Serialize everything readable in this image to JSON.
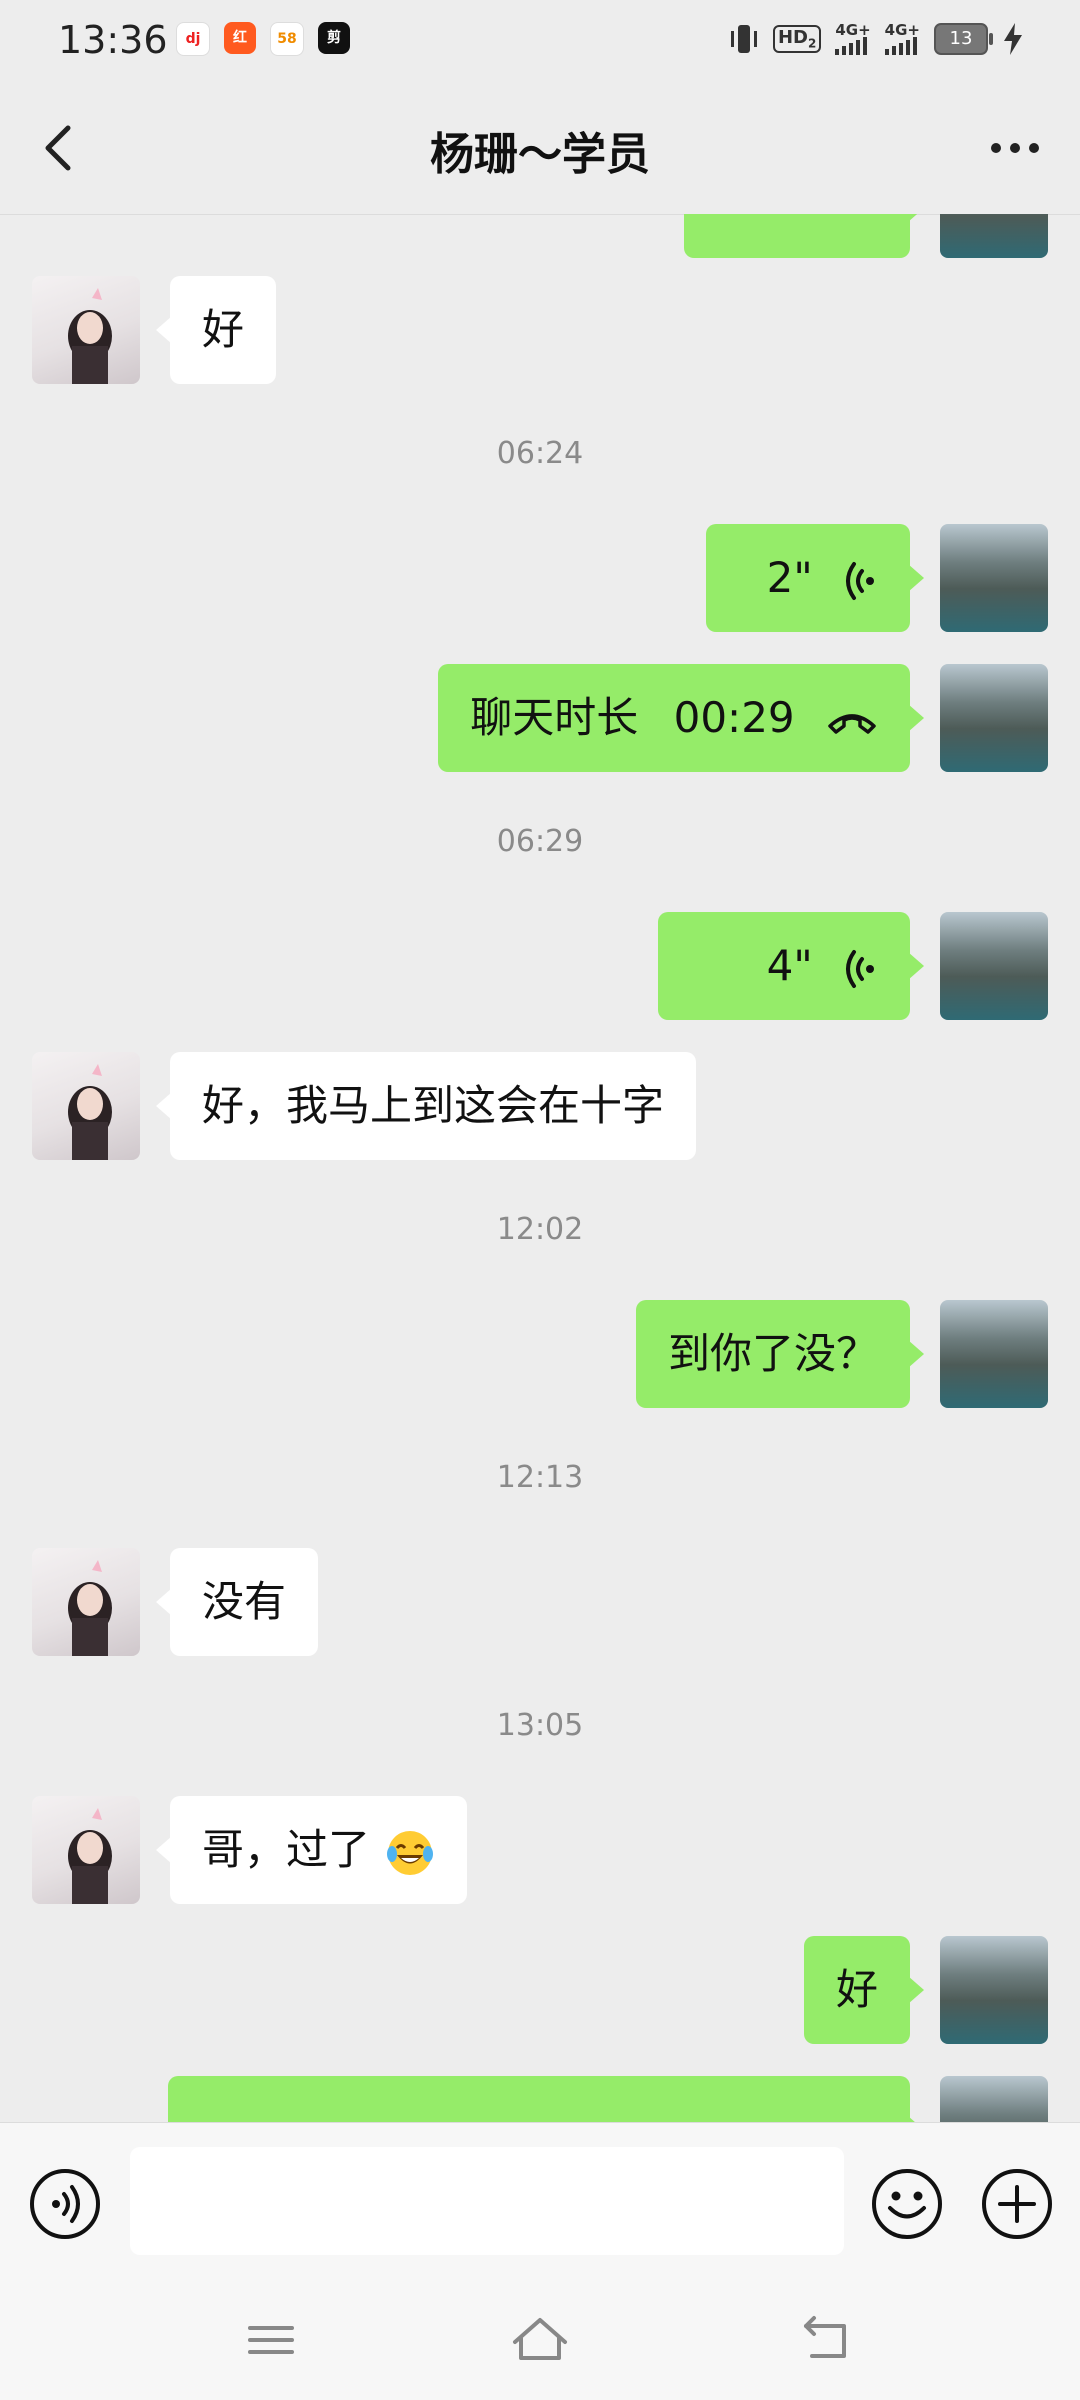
{
  "status_bar": {
    "time": "13:36",
    "apps": [
      "dj",
      "红",
      "58",
      "剪"
    ],
    "hd_label": "HD",
    "hd_sub": "2",
    "network_1": "4G+",
    "network_2": "4G+",
    "battery": "13"
  },
  "header": {
    "title": "杨珊～学员"
  },
  "messages": {
    "m1_text": "好",
    "t1": "06:24",
    "m2_duration": "2\"",
    "m3_label": "聊天时长",
    "m3_duration": "00:29",
    "t2": "06:29",
    "m4_duration": "4\"",
    "m5_text": "好，我马上到这会在十字",
    "t3": "12:02",
    "m6_text": "到你了没？",
    "t4": "12:13",
    "m7_text": "没有",
    "t5": "13:05",
    "m8_text": "哥，过了",
    "m9_text": "好"
  },
  "input": {
    "placeholder": ""
  },
  "colors": {
    "outgoing_bubble": "#95ec69",
    "incoming_bubble": "#ffffff",
    "background": "#ededed"
  },
  "icons": [
    "back-arrow-icon",
    "more-icon",
    "voice-wave-icon",
    "phone-hangup-icon",
    "voice-input-icon",
    "smiley-icon",
    "plus-icon",
    "menu-icon",
    "home-icon",
    "back-nav-icon",
    "laughing-emoji-icon"
  ]
}
